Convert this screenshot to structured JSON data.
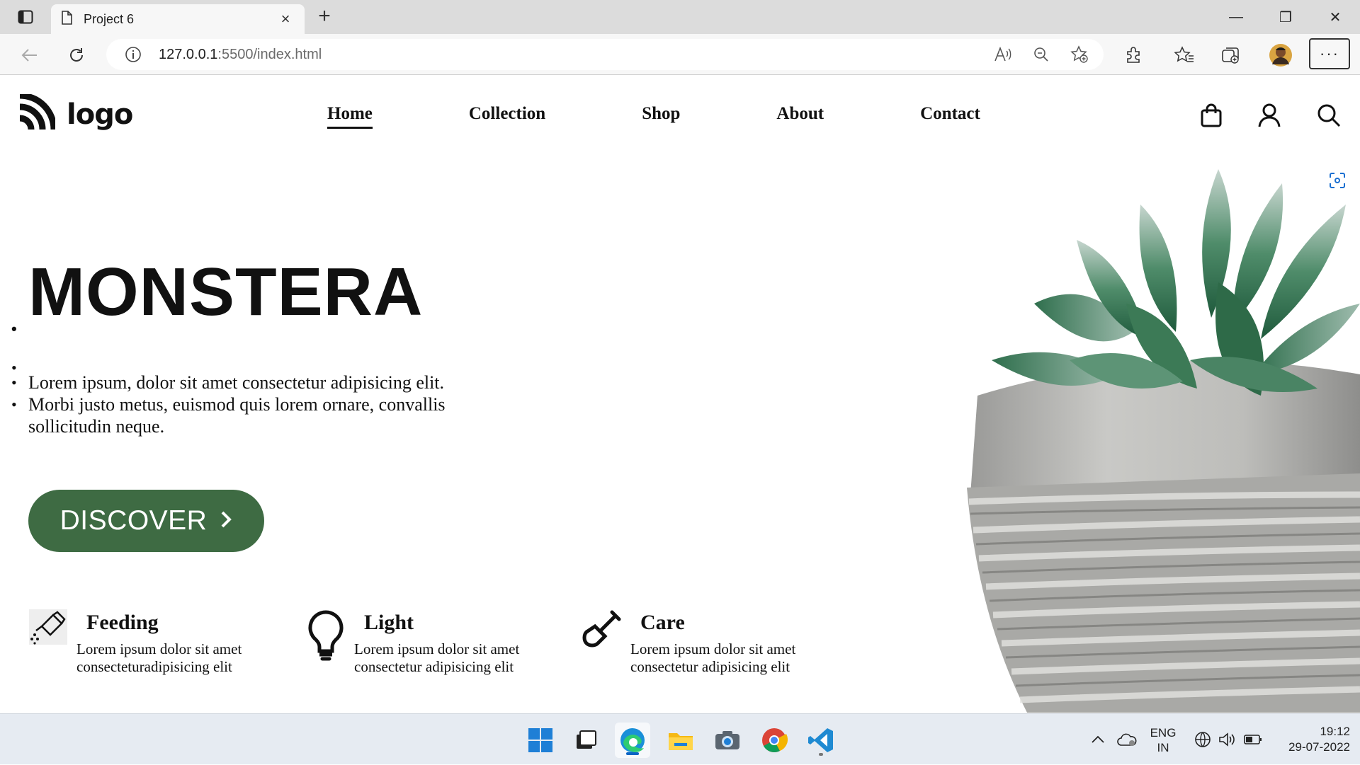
{
  "browser": {
    "tab_title": "Project 6",
    "tab_close": "×",
    "new_tab": "+",
    "url_host": "127.0.0.1",
    "url_path": ":5500/index.html",
    "menu": "···",
    "window_controls": {
      "minimize": "—",
      "restore": "❐",
      "close": "✕"
    }
  },
  "site": {
    "logo_text": "logo",
    "nav": [
      "Home",
      "Collection",
      "Shop",
      "About",
      "Contact"
    ],
    "active_nav": "Home",
    "hero": {
      "title": "MONSTERA",
      "line1": "Lorem ipsum, dolor sit amet consectetur adipisicing elit.",
      "line2": "Morbi justo metus, euismod quis lorem ornare, convallis sollicitudin neque."
    },
    "cta_label": "DISCOVER",
    "features": [
      {
        "title": "Feeding",
        "desc": "Lorem ipsum dolor sit amet consecteturadipisicing elit",
        "icon": "watering-can-icon"
      },
      {
        "title": "Light",
        "desc": "Lorem ipsum dolor sit amet consectetur adipisicing elit",
        "icon": "lightbulb-icon"
      },
      {
        "title": "Care",
        "desc": "Lorem ipsum dolor sit amet consectetur adipisicing elit",
        "icon": "shovel-icon"
      }
    ],
    "colors": {
      "cta_background": "#3e6b43",
      "text": "#111111"
    }
  },
  "taskbar": {
    "apps": [
      "windows-start-icon",
      "task-view-icon",
      "edge-icon",
      "file-explorer-icon",
      "camera-icon",
      "chrome-icon",
      "vscode-icon"
    ],
    "lang_line1": "ENG",
    "lang_line2": "IN",
    "time": "19:12",
    "date": "29-07-2022"
  }
}
